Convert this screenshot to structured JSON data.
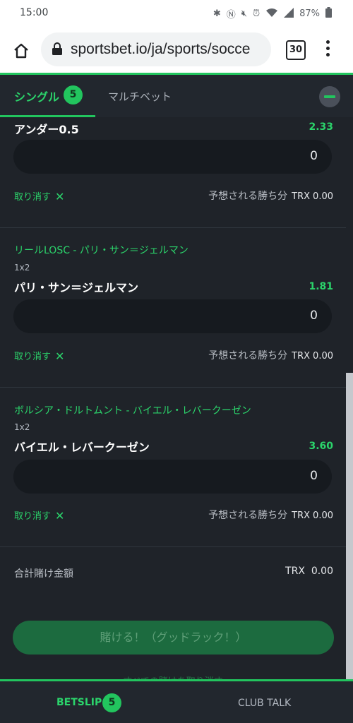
{
  "status": {
    "time": "15:00",
    "battery": "87%"
  },
  "browser": {
    "url": "sportsbet.io/ja/sports/socce",
    "tab_count": "30"
  },
  "tabs": {
    "single_label": "シングル",
    "single_count": "5",
    "multi_label": "マルチベット"
  },
  "bets": [
    {
      "match": "",
      "market": "",
      "selection": "アンダー0.5",
      "odds": "2.33",
      "stake": "0",
      "cancel": "取り消す",
      "win_label": "予想される勝ち分",
      "currency": "TRX",
      "win": "0.00"
    },
    {
      "match": "リールLOSC - パリ・サン＝ジェルマン",
      "market": "1x2",
      "selection": "パリ・サン＝ジェルマン",
      "odds": "1.81",
      "stake": "0",
      "cancel": "取り消す",
      "win_label": "予想される勝ち分",
      "currency": "TRX",
      "win": "0.00"
    },
    {
      "match": "ボルシア・ドルトムント - バイエル・レバークーゼン",
      "market": "1x2",
      "selection": "バイエル・レバークーゼン",
      "odds": "3.60",
      "stake": "0",
      "cancel": "取り消す",
      "win_label": "予想される勝ち分",
      "currency": "TRX",
      "win": "0.00"
    }
  ],
  "totals": {
    "label": "合計賭け金額",
    "currency": "TRX",
    "value": "0.00"
  },
  "place_bet": "賭ける！（グッドラック！）",
  "remove_all": "すべての賭けを取り消す",
  "bottom": {
    "betslip": "BETSLIP",
    "betslip_count": "5",
    "club_talk": "CLUB TALK"
  }
}
